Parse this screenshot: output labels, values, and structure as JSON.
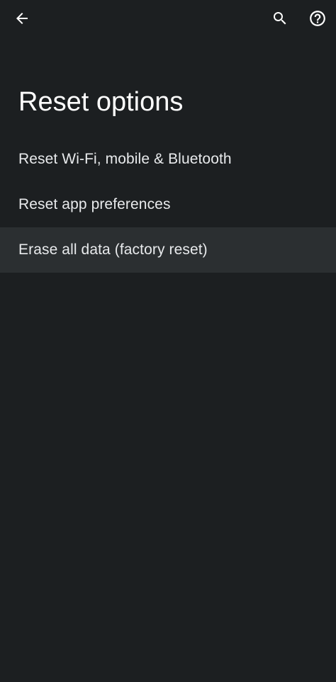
{
  "app_bar": {
    "back_icon": "arrow-back-icon",
    "search_icon": "search-icon",
    "help_icon": "help-circle-icon"
  },
  "page": {
    "title": "Reset options"
  },
  "options": [
    {
      "label": "Reset Wi-Fi, mobile & Bluetooth"
    },
    {
      "label": "Reset app preferences"
    },
    {
      "label": "Erase all data (factory reset)"
    }
  ],
  "colors": {
    "background": "#1c1f21",
    "pressed_row": "#2b2f31",
    "text": "#ffffff"
  }
}
